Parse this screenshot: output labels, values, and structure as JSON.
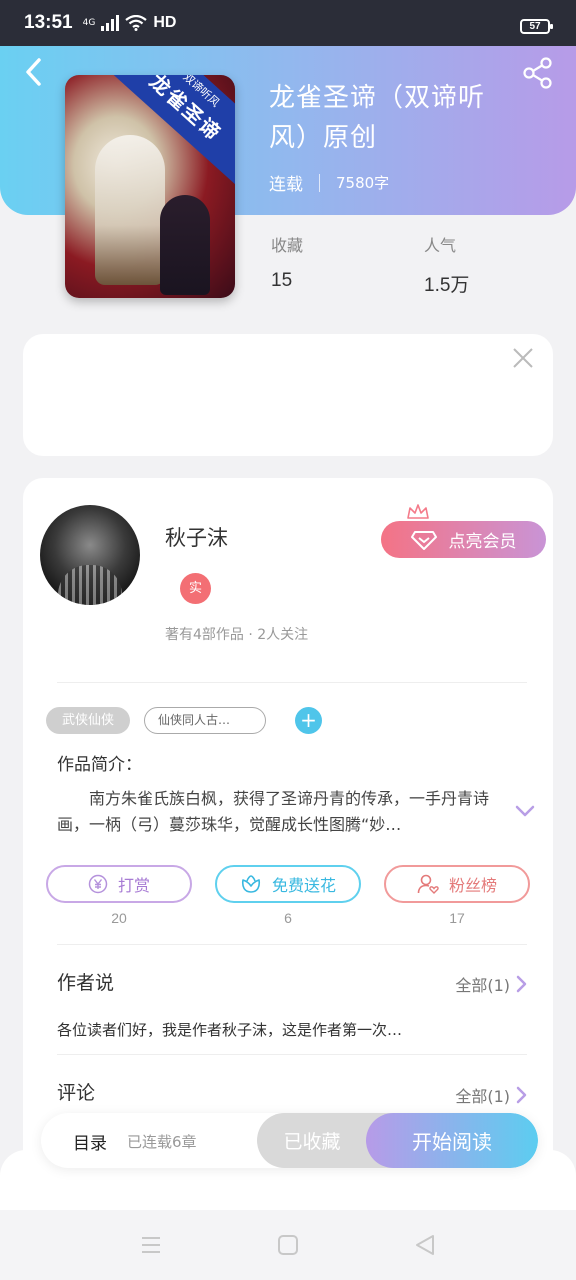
{
  "status_bar": {
    "time": "13:51",
    "network": "4G",
    "hd": "HD",
    "battery": "57"
  },
  "book": {
    "title": "龙雀圣谛（双谛听风）原创",
    "status": "连载",
    "word_count": "7580字",
    "cover": {
      "ribbon_small": "双谛听风",
      "ribbon_big": "龙雀圣谛"
    },
    "stats": [
      {
        "label": "收藏",
        "value": "15"
      },
      {
        "label": "人气",
        "value": "1.5万"
      }
    ]
  },
  "author": {
    "name": "秋子沫",
    "verified_badge": "实",
    "summary": "著有4部作品 · 2人关注",
    "vip_button": "点亮会员"
  },
  "tags": {
    "primary": "武侠仙侠",
    "secondary": "仙侠同人古…",
    "add": "+"
  },
  "intro": {
    "title": "作品简介：",
    "text": "南方朱雀氏族白枫，获得了圣谛丹青的传承，一手丹青诗画，一柄（弓）蔓莎珠华，觉醒成长性图腾“妙…"
  },
  "actions": [
    {
      "label": "打赏",
      "count": "20",
      "icon": "yen-icon"
    },
    {
      "label": "免费送花",
      "count": "6",
      "icon": "flower-icon"
    },
    {
      "label": "粉丝榜",
      "count": "17",
      "icon": "user-heart-icon"
    }
  ],
  "author_says": {
    "title": "作者说",
    "all_label": "全部(1)",
    "text": "各位读者们好，我是作者秋子沫，这是作者第一次…"
  },
  "comments": {
    "title": "评论",
    "all_label": "全部(1)"
  },
  "bottom_bar": {
    "toc": "目录",
    "chapters": "已连载6章",
    "collected": "已收藏",
    "read": "开始阅读"
  },
  "colors": {
    "header_gradient_start": "#6ad0f2",
    "header_gradient_end": "#b79be8",
    "vip_pink": "#f47385",
    "accent_blue": "#4fc5ea",
    "purple": "#a77bd4"
  }
}
